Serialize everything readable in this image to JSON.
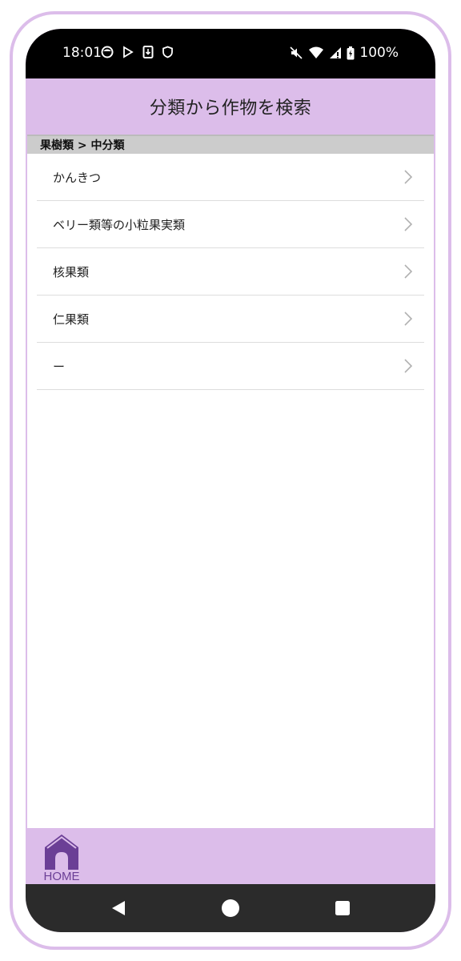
{
  "status_bar": {
    "time": "18:01",
    "battery": "100%",
    "left_icons": [
      "face-icon",
      "play-store-icon",
      "download-icon",
      "shield-icon"
    ],
    "right_icons": [
      "mute-icon",
      "wifi-icon",
      "signal-icon",
      "battery-icon"
    ]
  },
  "header": {
    "title": "分類から作物を検索"
  },
  "breadcrumb": "果樹類 > 中分類",
  "categories": [
    {
      "label": "かんきつ"
    },
    {
      "label": "ベリー類等の小粒果実類"
    },
    {
      "label": "核果類"
    },
    {
      "label": "仁果類"
    },
    {
      "label": "ー"
    }
  ],
  "footer": {
    "home_label": "HOME"
  },
  "colors": {
    "accent": "#dcbdea",
    "home_icon": "#6b3f96",
    "breadcrumb_bg": "#cccccc",
    "nav_bar": "#2b2b2b"
  }
}
